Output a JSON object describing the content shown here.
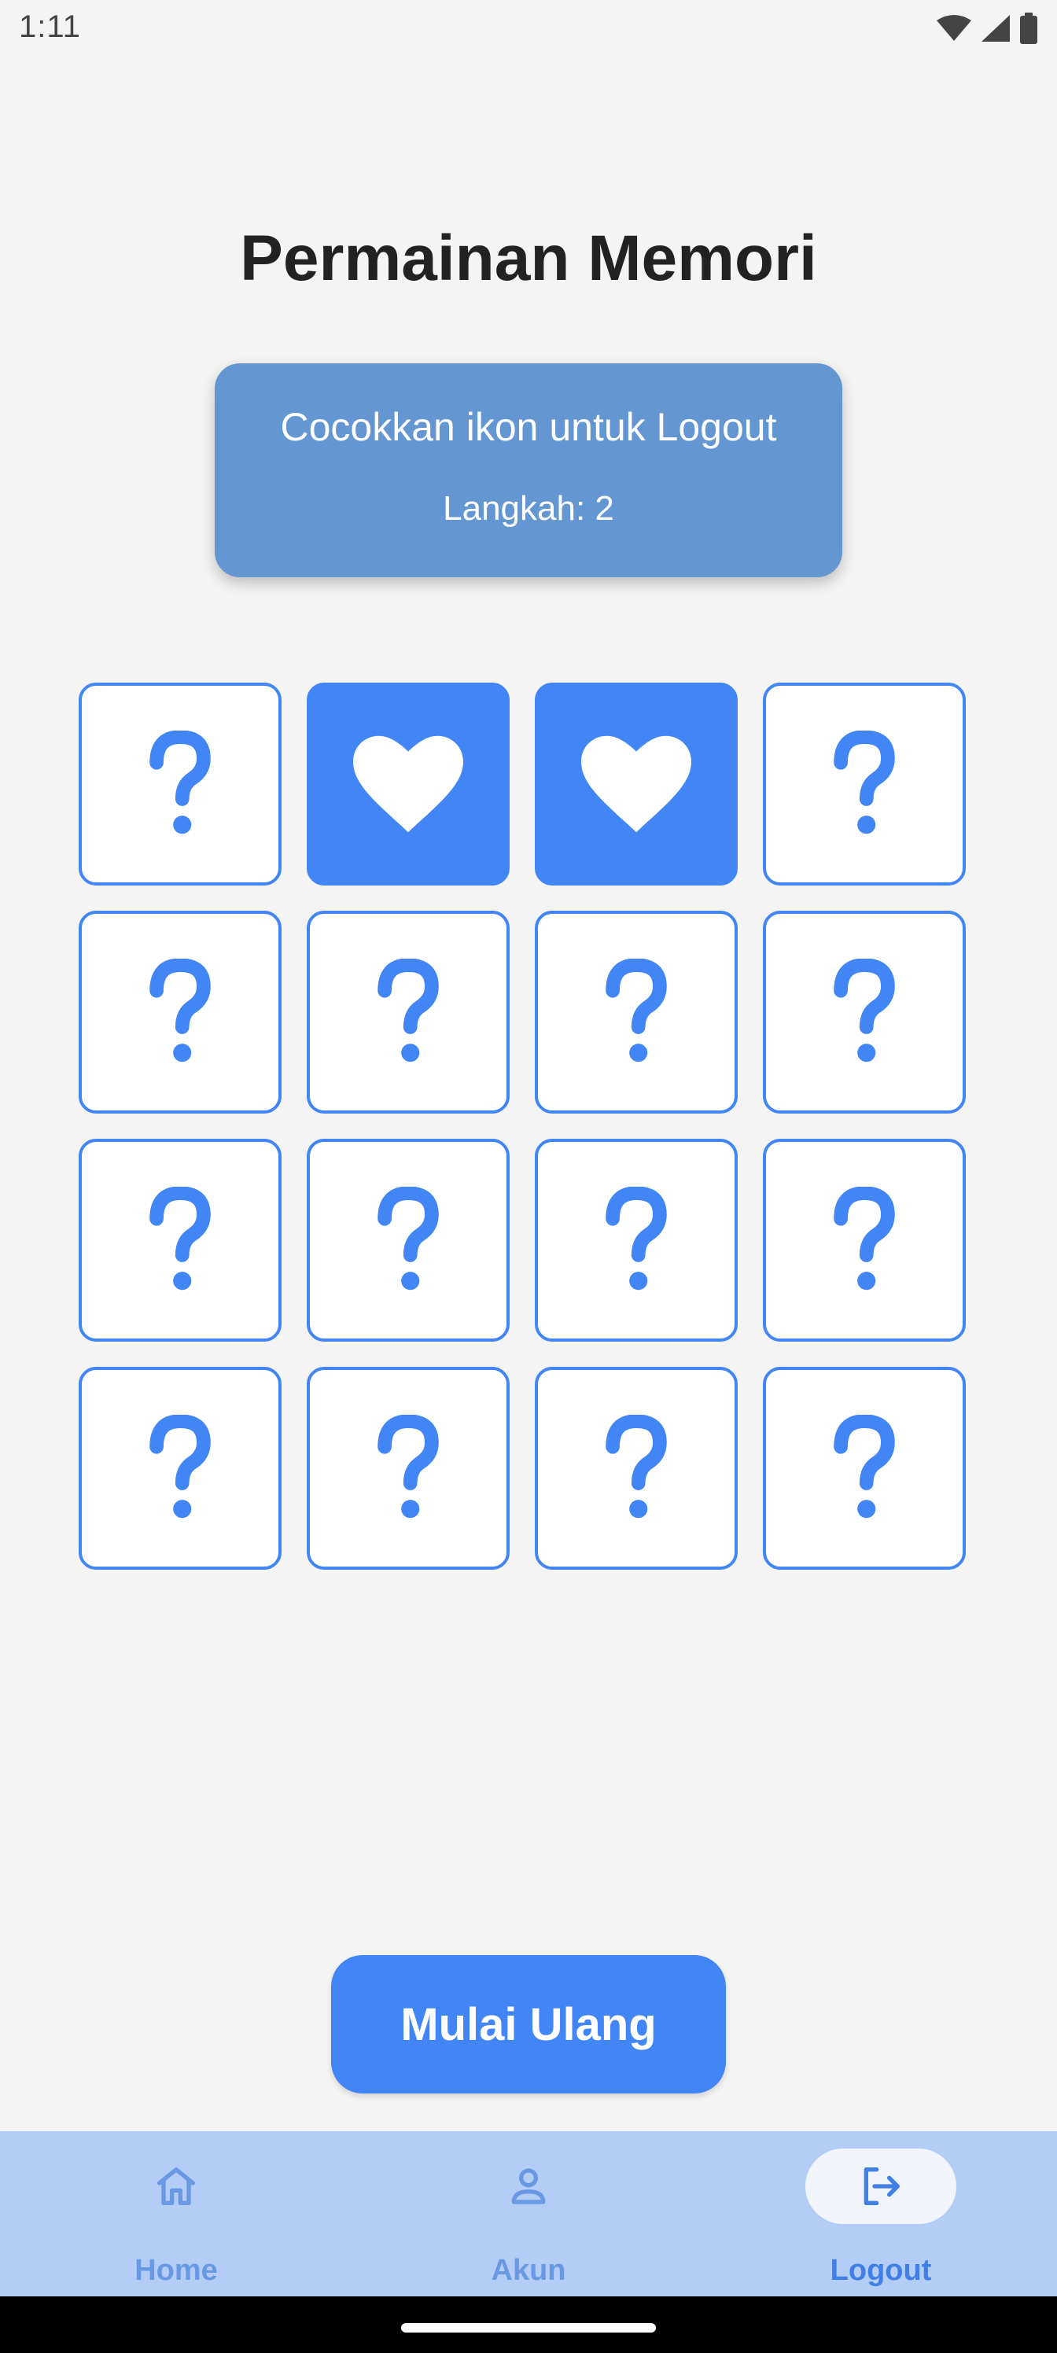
{
  "status_bar": {
    "time": "1:11"
  },
  "title": "Permainan Memori",
  "info": {
    "instruction": "Cocokkan ikon untuk Logout",
    "steps": "Langkah: 2"
  },
  "cards": [
    {
      "state": "hidden",
      "icon": "question-mark"
    },
    {
      "state": "revealed",
      "icon": "heart"
    },
    {
      "state": "revealed",
      "icon": "heart"
    },
    {
      "state": "hidden",
      "icon": "question-mark"
    },
    {
      "state": "hidden",
      "icon": "question-mark"
    },
    {
      "state": "hidden",
      "icon": "question-mark"
    },
    {
      "state": "hidden",
      "icon": "question-mark"
    },
    {
      "state": "hidden",
      "icon": "question-mark"
    },
    {
      "state": "hidden",
      "icon": "question-mark"
    },
    {
      "state": "hidden",
      "icon": "question-mark"
    },
    {
      "state": "hidden",
      "icon": "question-mark"
    },
    {
      "state": "hidden",
      "icon": "question-mark"
    },
    {
      "state": "hidden",
      "icon": "question-mark"
    },
    {
      "state": "hidden",
      "icon": "question-mark"
    },
    {
      "state": "hidden",
      "icon": "question-mark"
    },
    {
      "state": "hidden",
      "icon": "question-mark"
    }
  ],
  "restart_button": {
    "label": "Mulai Ulang"
  },
  "bottom_nav": {
    "items": [
      {
        "label": "Home",
        "icon": "home-icon",
        "active": false
      },
      {
        "label": "Akun",
        "icon": "person-icon",
        "active": false
      },
      {
        "label": "Logout",
        "icon": "logout-icon",
        "active": true
      }
    ]
  },
  "colors": {
    "accent": "#4285f4",
    "info_card": "#6496d2",
    "nav_background": "#b3cdf7",
    "nav_label": "#6a99e3",
    "nav_label_active": "#3f7fe6",
    "background": "#f4f4f4"
  }
}
